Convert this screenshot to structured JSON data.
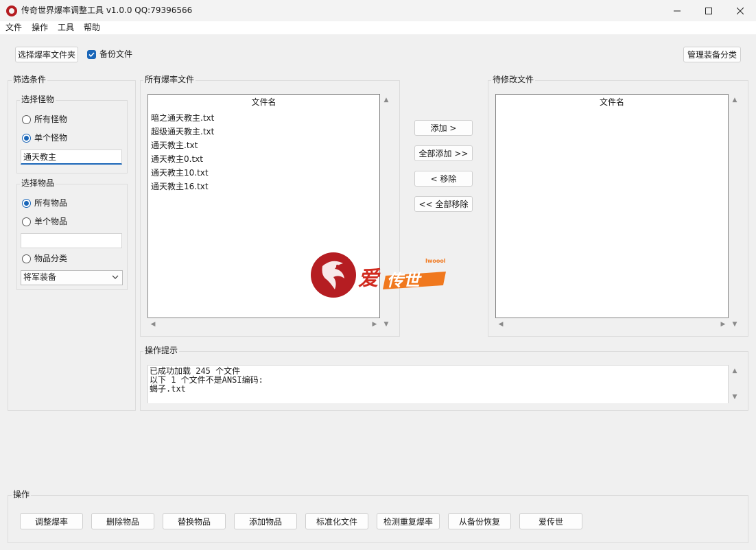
{
  "window": {
    "title": "传奇世界爆率调整工具 v1.0.0 QQ:79396566"
  },
  "menu": [
    "文件",
    "操作",
    "工具",
    "帮助"
  ],
  "toolbar": {
    "select_folder": "选择爆率文件夹",
    "backup_label": "备份文件",
    "backup_checked": true,
    "manage_categories": "管理装备分类"
  },
  "filter": {
    "title": "筛选条件",
    "monster": {
      "title": "选择怪物",
      "all_label": "所有怪物",
      "single_label": "单个怪物",
      "selected": "single",
      "value": "通天教主"
    },
    "item": {
      "title": "选择物品",
      "all_label": "所有物品",
      "single_label": "单个物品",
      "category_label": "物品分类",
      "selected": "all",
      "value": "",
      "category_value": "将军装备"
    }
  },
  "all_files": {
    "title": "所有爆率文件",
    "header": "文件名",
    "items": [
      "暗之通天教主.txt",
      "超级通天教主.txt",
      "通天教主.txt",
      "通天教主0.txt",
      "通天教主10.txt",
      "通天教主16.txt"
    ]
  },
  "transfer": {
    "add": "添加 >",
    "add_all": "全部添加 >>",
    "remove": "< 移除",
    "remove_all": "<< 全部移除"
  },
  "pending_files": {
    "title": "待修改文件",
    "header": "文件名",
    "items": []
  },
  "hints": {
    "title": "操作提示",
    "lines": [
      "已成功加载 245 个文件",
      "以下 1 个文件不是ANSI编码:",
      "蝎子.txt"
    ]
  },
  "watermark": {
    "brand": "爱传世",
    "tag": "Iwoool"
  },
  "actions": {
    "title": "操作",
    "buttons": [
      "调整爆率",
      "删除物品",
      "替换物品",
      "添加物品",
      "标准化文件",
      "检测重复爆率",
      "从备份恢复",
      "爱传世"
    ]
  },
  "colors": {
    "accent": "#1a66b8",
    "watermark_red": "#b51d22",
    "watermark_orange": "#f0781e"
  }
}
